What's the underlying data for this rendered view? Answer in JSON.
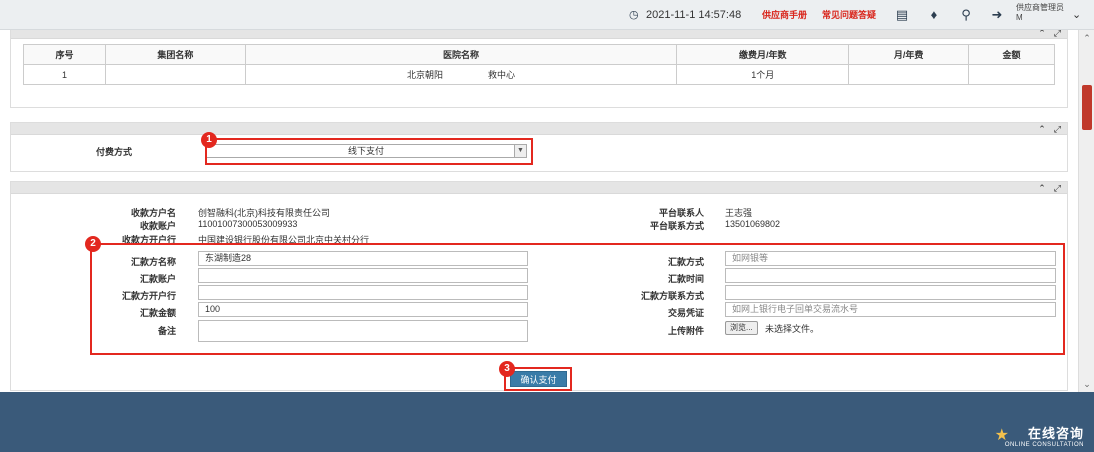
{
  "topbar": {
    "datetime": "2021-11-1  14:57:48",
    "supplier_manual": "供应商手册",
    "faq": "常见问题答疑",
    "user_line1": "供应商管理员",
    "user_line2": "M"
  },
  "hospital_table": {
    "headers": [
      "序号",
      "集团名称",
      "医院名称",
      "缴费月/年数",
      "月/年费",
      "金额"
    ],
    "row": {
      "index": "1",
      "group": "",
      "hospital": "北京朝阳                  救中心",
      "duration": "1个月",
      "fee": "",
      "amount": ""
    }
  },
  "payment": {
    "label": "付费方式",
    "selected": "线下支付"
  },
  "payee": {
    "name_label": "收款方户名",
    "name_value": "创智融科(北京)科技有限责任公司",
    "account_label": "收款账户",
    "account_value": "11001007300053009933",
    "bank_label": "收款方开户行",
    "bank_value": "中国建设银行股份有限公司北京中关村分行",
    "contact_label": "平台联系人",
    "contact_value": "王志强",
    "phone_label": "平台联系方式",
    "phone_value": "13501069802"
  },
  "remit_form": {
    "payer_name_label": "汇款方名称",
    "payer_name_value": "东湖制造28",
    "payer_account_label": "汇款账户",
    "payer_account_value": "",
    "payer_bank_label": "汇款方开户行",
    "payer_bank_value": "",
    "amount_label": "汇款金额",
    "amount_value": "100",
    "note_label": "备注",
    "note_value": "",
    "method_label": "汇款方式",
    "method_placeholder": "如网银等",
    "time_label": "汇款时间",
    "time_value": "",
    "payer_contact_label": "汇款方联系方式",
    "payer_contact_value": "",
    "voucher_label": "交易凭证",
    "voucher_placeholder": "如网上银行电子回单交易流水号",
    "upload_label": "上传附件",
    "browse_label": "浏览...",
    "no_file_text": "未选择文件。"
  },
  "confirm_label": "确认支付",
  "badges": [
    "1",
    "2",
    "3"
  ],
  "consult": {
    "title": "在线咨询",
    "subtitle": "ONLINE CONSULTATION"
  },
  "colors": {
    "highlight_red": "#e3281f",
    "footer_blue": "#3a5a7a",
    "button_blue": "#3a7ca8"
  }
}
